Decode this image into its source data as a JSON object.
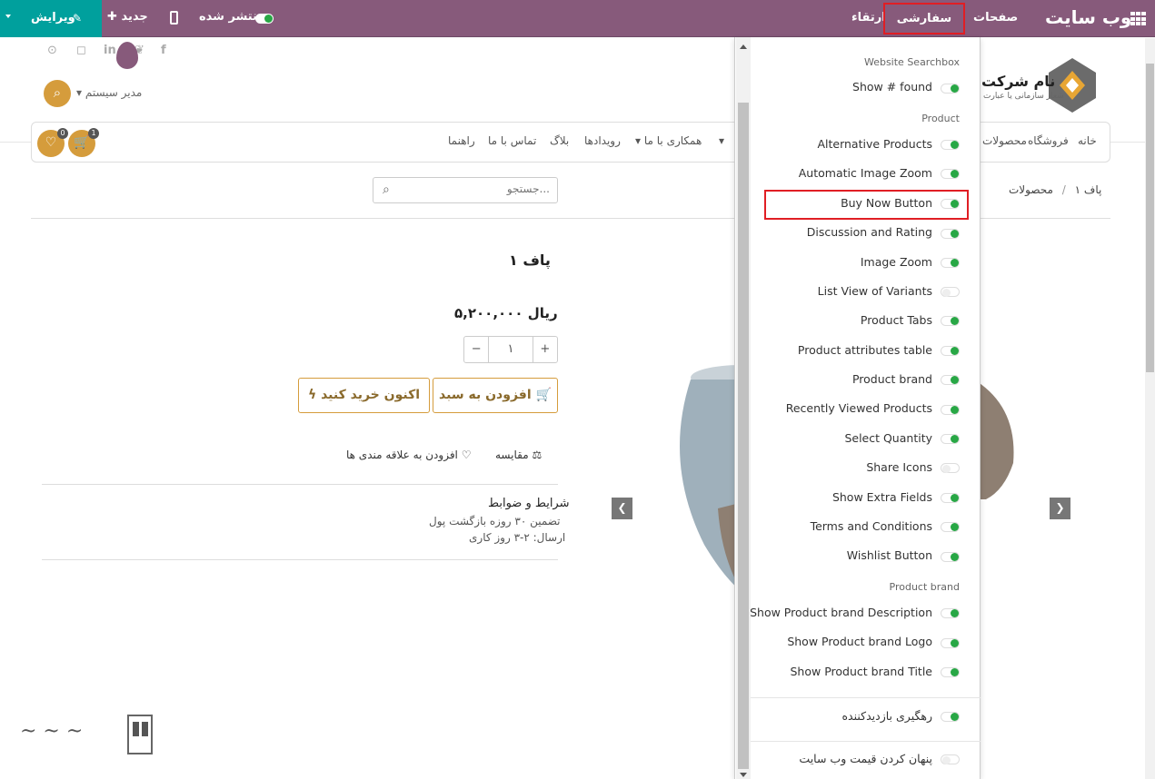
{
  "topbar": {
    "edit_label": "ویرایش",
    "new_label": "جدید",
    "publish_label": "منتشر شده",
    "nav_upgrade": "ارتقاء",
    "nav_customize": "سفارشی سازی",
    "nav_pages": "صفحات",
    "app_title": "وب سایت",
    "accent_color": "#875a7b",
    "edit_color": "#00a09d"
  },
  "header": {
    "user_name": "مدیر سیستم",
    "company_name": "نام شرکت",
    "company_tag": "شعار سازمانی یا عبارت",
    "cart_count": "1",
    "wishlist_count": "0",
    "menu": [
      "خانه",
      "فروشگاه",
      "محصولات",
      "همکاری با ما",
      "رویدادها",
      "بلاگ",
      "تماس با ما",
      "راهنما"
    ]
  },
  "search": {
    "placeholder": "جستجو..."
  },
  "breadcrumb": {
    "root": "محصولات",
    "sep": "/",
    "current": "پاف ۱"
  },
  "product": {
    "name": "پاف ۱",
    "price": "۵,۲۰۰,۰۰۰ ریال",
    "qty": "۱",
    "qty_minus": "−",
    "qty_plus": "+",
    "add_to_cart": "افزودن به سبد",
    "buy_now": "اکنون خرید کنید",
    "compare": "مقایسه",
    "wishlist": "افزودن به علاقه مندی ها",
    "terms_title": "شرایط و ضوابط",
    "terms_line1": "تضمین ۳۰ روزه بازگشت پول",
    "terms_line2": "ارسال: ۲-۳ روز کاری"
  },
  "panel": {
    "sec_searchbox": "Website Searchbox",
    "opt_show_found": "Show # found",
    "sec_product": "Product",
    "opt_alt_products": "Alternative Products",
    "opt_auto_zoom": "Automatic Image Zoom",
    "opt_buy_now": "Buy Now Button",
    "opt_discussion": "Discussion and Rating",
    "opt_image_zoom": "Image Zoom",
    "opt_list_variants": "List View of Variants",
    "opt_product_tabs": "Product Tabs",
    "opt_attr_table": "Product attributes table",
    "opt_product_brand": "Product brand",
    "opt_recently_viewed": "Recently Viewed Products",
    "opt_select_qty": "Select Quantity",
    "opt_share_icons": "Share Icons",
    "opt_extra_fields": "Show Extra Fields",
    "opt_terms": "Terms and Conditions",
    "opt_wishlist": "Wishlist Button",
    "sec_brand": "Product brand",
    "opt_brand_desc": "Show Product brand Description",
    "opt_brand_logo": "Show Product brand Logo",
    "opt_brand_title": "Show Product brand Title",
    "opt_tracking": "رهگیری بازدیدکننده",
    "opt_hide_price": "پنهان کردن قیمت وب سایت"
  }
}
